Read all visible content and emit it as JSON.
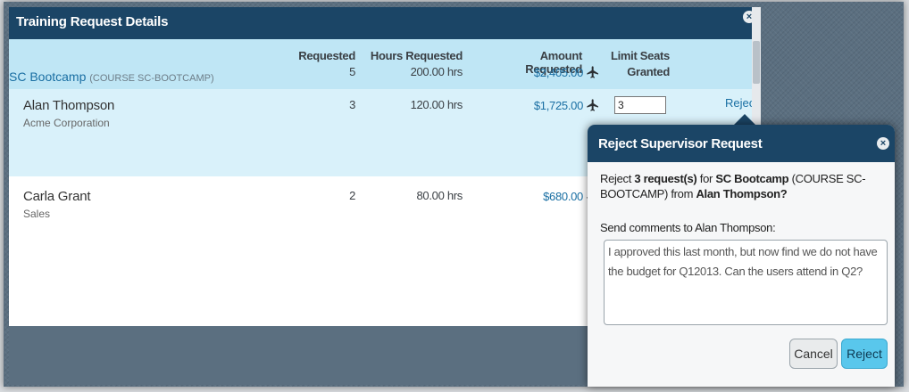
{
  "dialog": {
    "title": "Training Request Details",
    "close_glyph": "×"
  },
  "columns": {
    "requested": "Requested",
    "hours": "Hours Requested",
    "amount": "Amount Requested",
    "limit_line1": "Limit Seats",
    "limit_line2": "Granted"
  },
  "course": {
    "name": "SC Bootcamp",
    "code": "(COURSE SC-BOOTCAMP)",
    "requested": "5",
    "hours": "200.00 hrs",
    "amount": "$2,405.00"
  },
  "rows": [
    {
      "name": "Alan Thompson",
      "org": "Acme Corporation",
      "requested": "3",
      "hours": "120.00 hrs",
      "amount": "$1,725.00",
      "seats_value": "3",
      "action": "Reject"
    },
    {
      "name": "Carla Grant",
      "org": "Sales",
      "requested": "2",
      "hours": "80.00 hrs",
      "amount": "$680.00"
    }
  ],
  "popup": {
    "title": "Reject Supervisor Request",
    "msg_prefix": "Reject ",
    "msg_count": "3 request(s)",
    "msg_for": " for ",
    "msg_course": "SC Bootcamp",
    "msg_code": " (COURSE SC-BOOTCAMP)",
    "msg_from": " from ",
    "msg_person": "Alan Thompson?",
    "comments_label": "Send comments to Alan Thompson:",
    "comments_value": "I approved this last month, but now find we do not have the budget for Q12013. Can the users attend in Q2?",
    "cancel_label": "Cancel",
    "reject_label": "Reject"
  },
  "icons": {
    "travel": "airplane-icon",
    "close": "close-icon"
  },
  "colors": {
    "header": "#1b4566",
    "link": "#1a6fa3",
    "course_row": "#bfe6f5",
    "selected_row": "#d9f1fa",
    "reject_button": "#59c7ec"
  }
}
